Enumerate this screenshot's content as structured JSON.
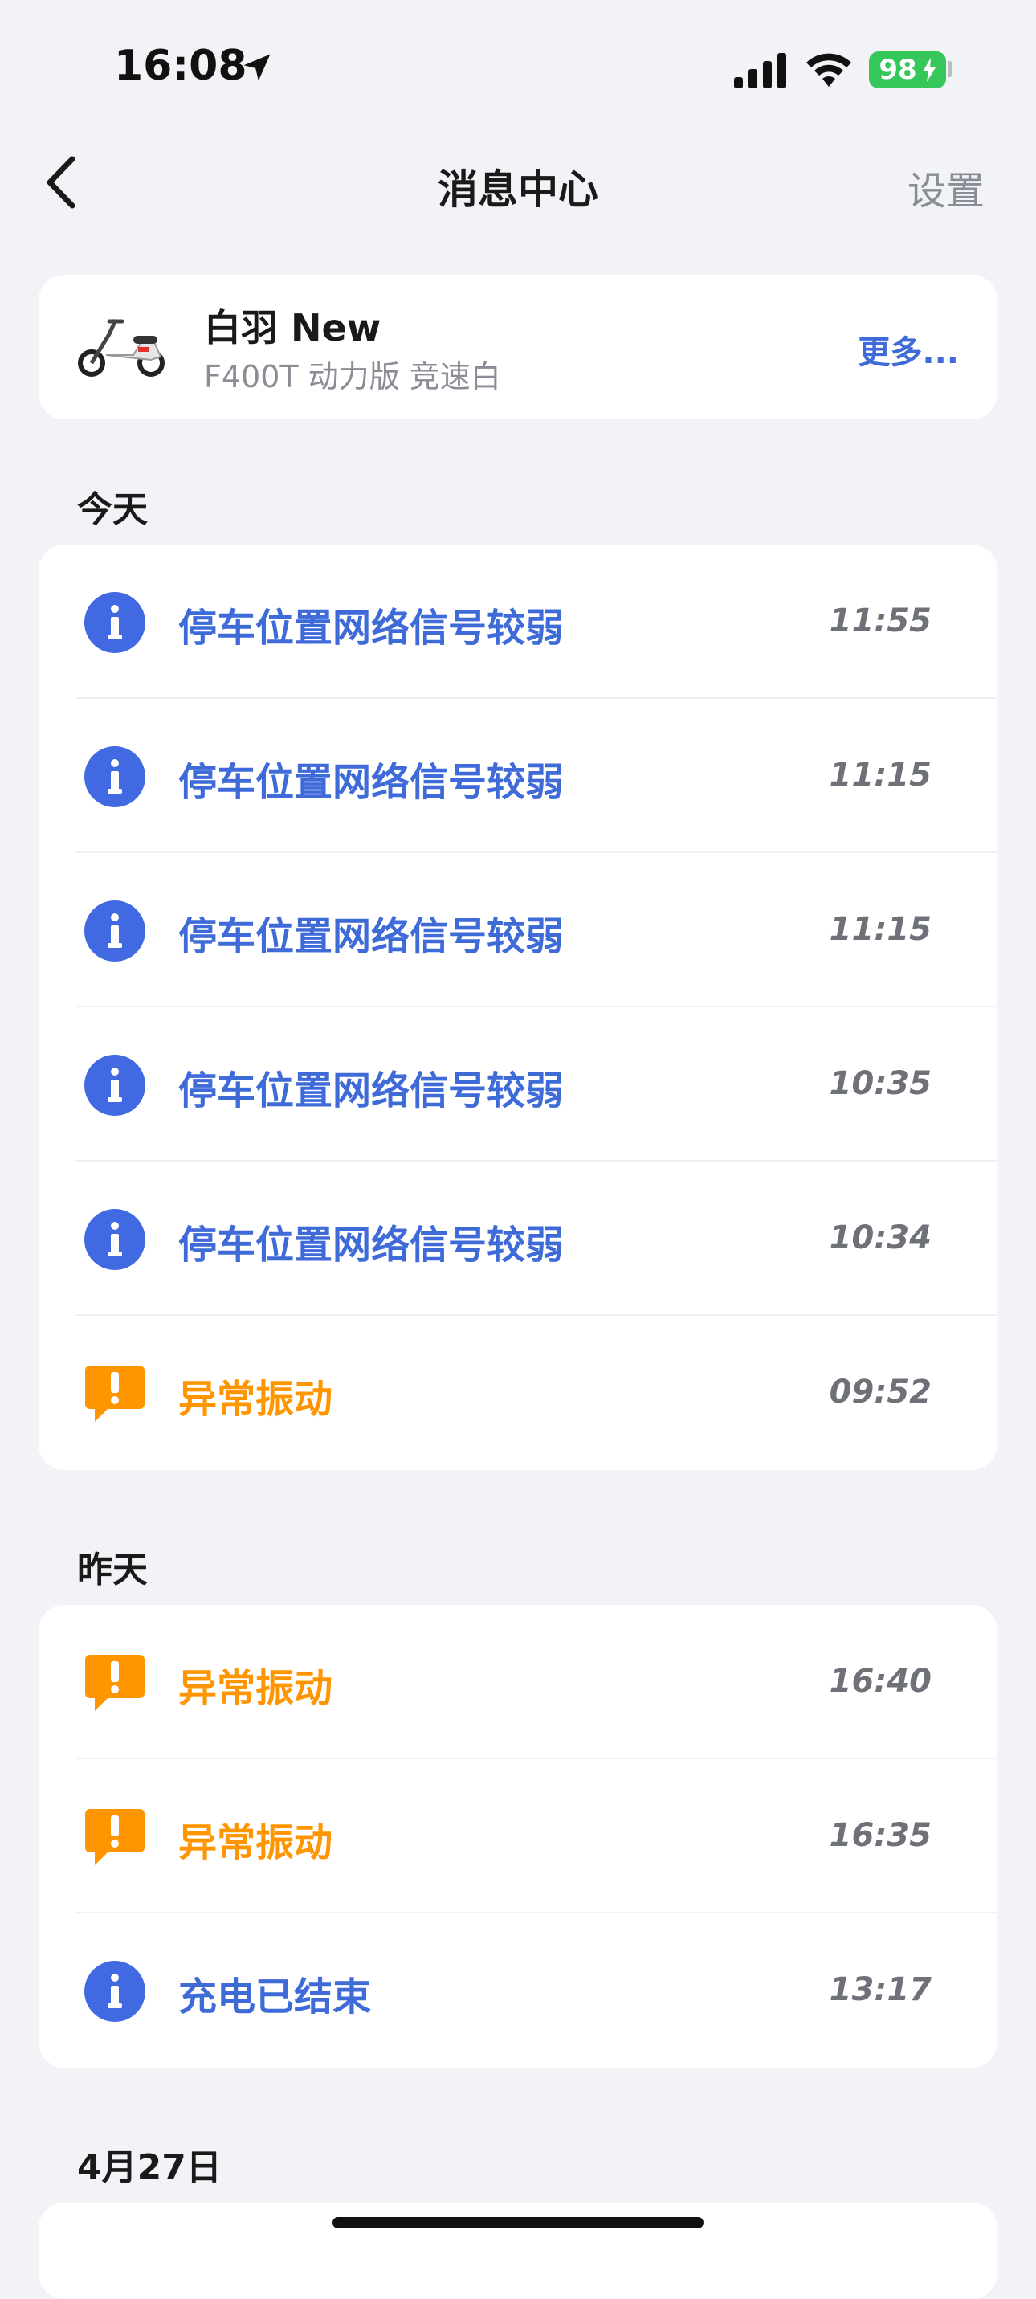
{
  "status_bar": {
    "time": "16:08",
    "battery": "98"
  },
  "nav": {
    "title": "消息中心",
    "settings": "设置"
  },
  "vehicle": {
    "name": "白羽 New",
    "model": "F400T 动力版 竞速白",
    "more": "更多..."
  },
  "sections": [
    {
      "header": "今天",
      "items": [
        {
          "type": "info",
          "title": "停车位置网络信号较弱",
          "time": "11:55"
        },
        {
          "type": "info",
          "title": "停车位置网络信号较弱",
          "time": "11:15"
        },
        {
          "type": "info",
          "title": "停车位置网络信号较弱",
          "time": "11:15"
        },
        {
          "type": "info",
          "title": "停车位置网络信号较弱",
          "time": "10:35"
        },
        {
          "type": "info",
          "title": "停车位置网络信号较弱",
          "time": "10:34"
        },
        {
          "type": "warn",
          "title": "异常振动",
          "time": "09:52"
        }
      ]
    },
    {
      "header": "昨天",
      "items": [
        {
          "type": "warn",
          "title": "异常振动",
          "time": "16:40"
        },
        {
          "type": "warn",
          "title": "异常振动",
          "time": "16:35"
        },
        {
          "type": "info",
          "title": "充电已结束",
          "time": "13:17"
        }
      ]
    },
    {
      "header": "4月27日",
      "items": []
    }
  ],
  "colors": {
    "accent": "#3f6bd8",
    "warning": "#ff9500",
    "background": "#f2f3f7"
  },
  "icons": {
    "info": "info-circle-icon",
    "warn": "warning-bubble-icon"
  }
}
